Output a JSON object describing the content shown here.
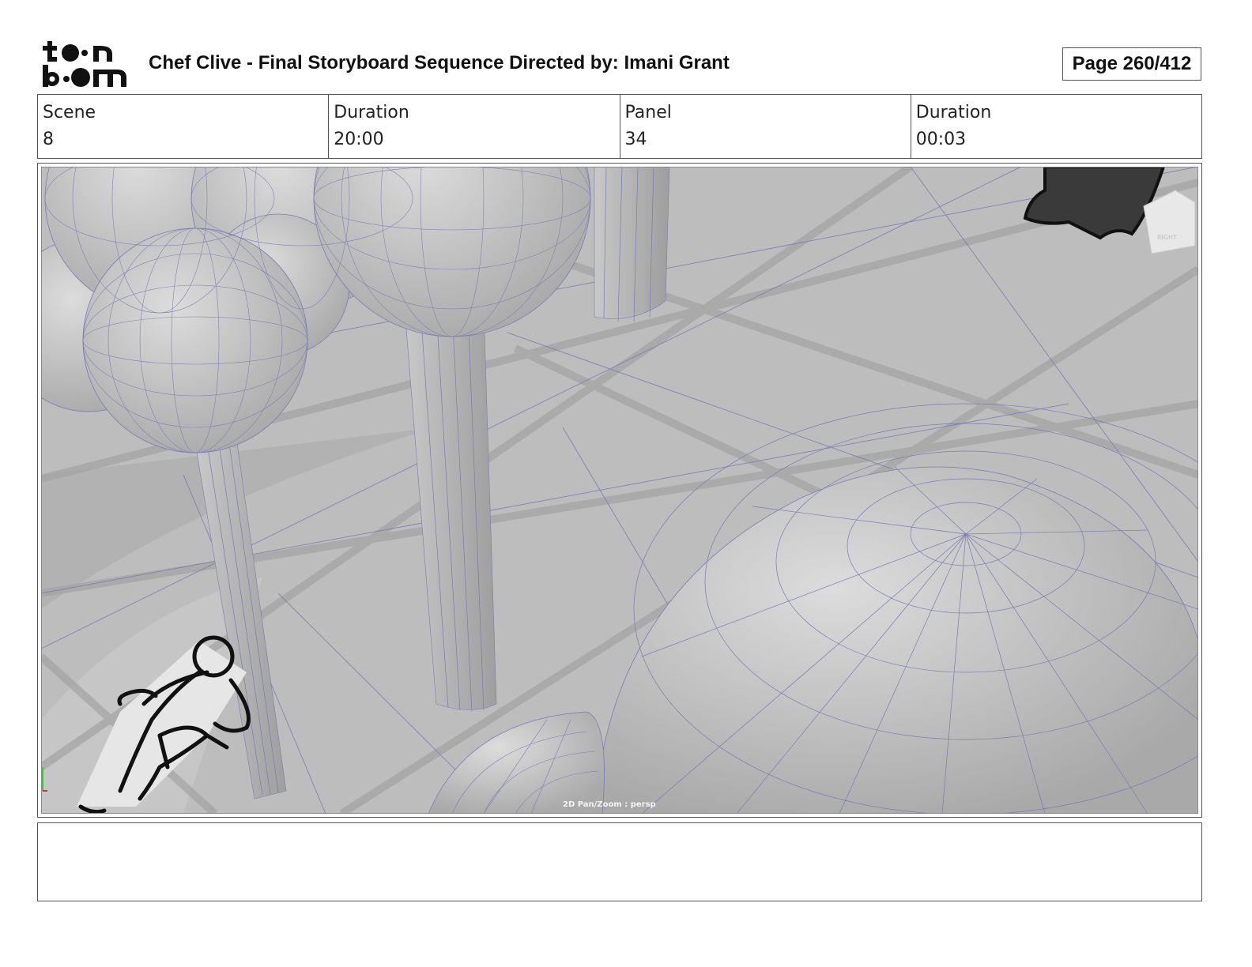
{
  "header": {
    "logo": {
      "line1": "toon",
      "line2": "boom",
      "icon": "toon-boom-logo"
    },
    "title": "Chef Clive - Final Storyboard Sequence  Directed by: Imani Grant",
    "page": "Page 260/412"
  },
  "info": [
    {
      "label": "Scene",
      "value": "8"
    },
    {
      "label": "Duration",
      "value": "20:00"
    },
    {
      "label": "Panel",
      "value": "34"
    },
    {
      "label": "Duration",
      "value": "00:03"
    }
  ],
  "panel": {
    "viewport_label": "2D Pan/Zoom : persp",
    "view_cube_label": "RIGHT",
    "colors": {
      "background": "#bdbdbd",
      "wireframe": "#6f6fb0",
      "shape": "#cfcfcf",
      "sketch": "#111111"
    }
  },
  "notes": {
    "text": ""
  }
}
